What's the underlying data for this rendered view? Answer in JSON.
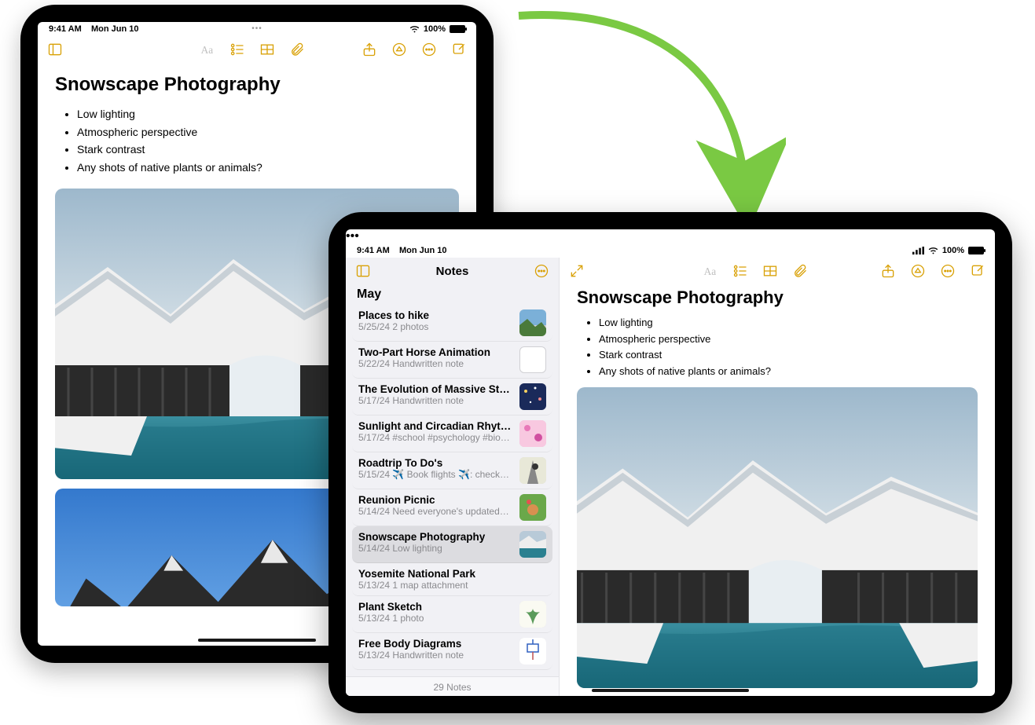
{
  "status": {
    "time": "9:41 AM",
    "date": "Mon Jun 10",
    "battery_pct": "100%"
  },
  "app_dots": "•••",
  "note": {
    "title": "Snowscape Photography",
    "bullets": [
      "Low lighting",
      "Atmospheric perspective",
      "Stark contrast",
      "Any shots of native plants or animals?"
    ]
  },
  "sidebar": {
    "title": "Notes",
    "section": "May",
    "footer": "29 Notes",
    "items": [
      {
        "title": "Places to hike",
        "date": "5/25/24",
        "preview": "2 photos",
        "thumb": "landscape"
      },
      {
        "title": "Two-Part Horse Animation",
        "date": "5/22/24",
        "preview": "Handwritten note",
        "thumb": "blank"
      },
      {
        "title": "The Evolution of Massive Star…",
        "date": "5/17/24",
        "preview": "Handwritten note",
        "thumb": "stars"
      },
      {
        "title": "Sunlight and Circadian Rhyth…",
        "date": "5/17/24",
        "preview": "#school #psychology #bio…",
        "thumb": "pink"
      },
      {
        "title": "Roadtrip To Do's",
        "date": "5/15/24",
        "preview": "✈️ Book flights ✈️: check…",
        "thumb": "road"
      },
      {
        "title": "Reunion Picnic",
        "date": "5/14/24",
        "preview": "Need everyone's updated…",
        "thumb": "picnic"
      },
      {
        "title": "Snowscape Photography",
        "date": "5/14/24",
        "preview": "Low lighting",
        "thumb": "snow",
        "selected": true
      },
      {
        "title": "Yosemite National Park",
        "date": "5/13/24",
        "preview": "1 map attachment",
        "thumb": "none"
      },
      {
        "title": "Plant Sketch",
        "date": "5/13/24",
        "preview": "1 photo",
        "thumb": "plant"
      },
      {
        "title": "Free Body Diagrams",
        "date": "5/13/24",
        "preview": "Handwritten note",
        "thumb": "diagram"
      }
    ]
  }
}
